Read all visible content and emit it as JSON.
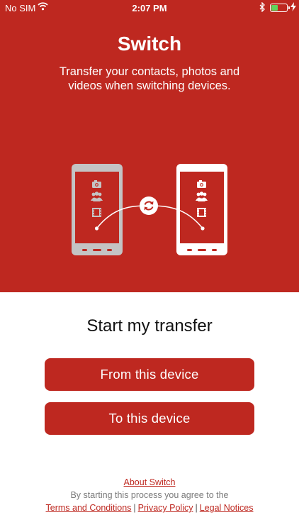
{
  "status_bar": {
    "carrier": "No SIM",
    "time": "2:07 PM",
    "battery_level": 0.45,
    "battery_color": "#5fd45c"
  },
  "hero": {
    "title": "Switch",
    "subtitle": "Transfer your contacts, photos and videos when switching devices.",
    "background_color": "#be2820",
    "illustration": {
      "source_device_icons": [
        "camera-icon",
        "contacts-icon",
        "film-icon"
      ],
      "target_device_icons": [
        "camera-icon",
        "contacts-icon",
        "film-icon"
      ],
      "center_icon": "sync-icon"
    }
  },
  "main": {
    "heading": "Start my transfer",
    "from_button_label": "From this device",
    "to_button_label": "To this device"
  },
  "footer": {
    "about_link": "About Switch",
    "agree_text": "By starting this process you agree to the",
    "terms_link": "Terms and Conditions",
    "privacy_link": "Privacy Policy",
    "legal_link": "Legal Notices",
    "separator": "|"
  }
}
